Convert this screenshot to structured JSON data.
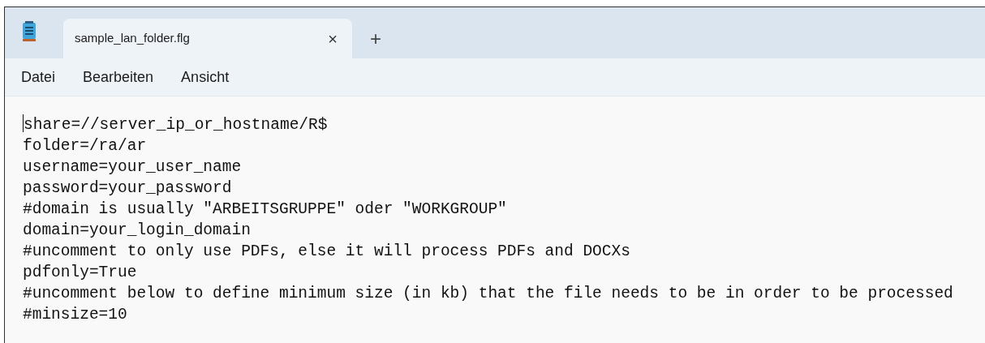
{
  "tabs": [
    {
      "label": "sample_lan_folder.flg",
      "selected": true,
      "close": "×"
    }
  ],
  "new_tab": "+",
  "menu": [
    "Datei",
    "Bearbeiten",
    "Ansicht"
  ],
  "editor": {
    "lines": [
      "share=//server_ip_or_hostname/R$",
      "folder=/ra/ar",
      "username=your_user_name",
      "password=your_password",
      "#domain is usually \"ARBEITSGRUPPE\" oder \"WORKGROUP\"",
      "domain=your_login_domain",
      "#uncomment to only use PDFs, else it will process PDFs and DOCXs",
      "pdfonly=True",
      "#uncomment below to define minimum size (in kb) that the file needs to be in order to be processed",
      "#minsize=10"
    ]
  }
}
